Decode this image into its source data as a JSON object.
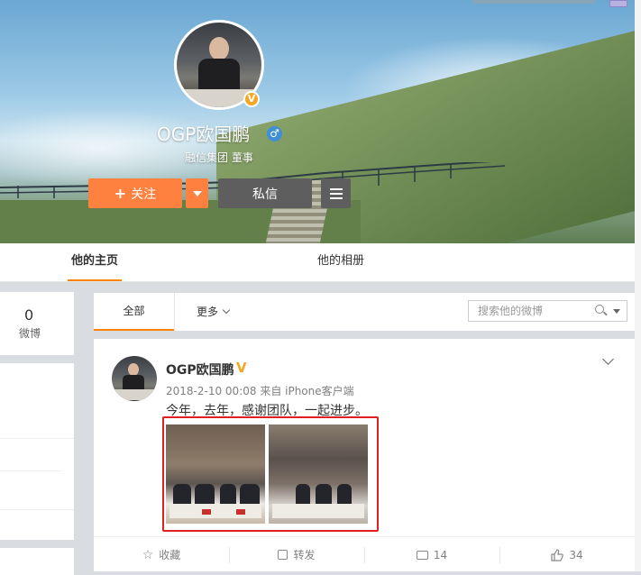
{
  "profile": {
    "name": "OGP欧国鹏",
    "description": "融信集团 董事",
    "verified_badge": "V",
    "gender": "♂",
    "follow_label": "关注",
    "message_label": "私信"
  },
  "tabs": [
    {
      "label": "他的主页",
      "active": true
    },
    {
      "label": "他的相册",
      "active": false
    }
  ],
  "stats": {
    "weibo_count": "0",
    "weibo_label": "微博"
  },
  "filter": {
    "all_label": "全部",
    "more_label": "更多",
    "search_placeholder": "搜索他的微博"
  },
  "post": {
    "author": "OGP欧国鹏",
    "verified_badge": "V",
    "meta": "2018-2-10 00:08 来自 iPhone客户端",
    "text": "今年，去年，感谢团队，一起进步。",
    "actions": {
      "favorite_label": "收藏",
      "repost_label": "转发",
      "comment_count": "14",
      "like_count": "34"
    }
  },
  "icons": {
    "favorite": "star-icon",
    "repost": "share-icon",
    "comment": "comment-icon",
    "like": "thumbs-up-icon",
    "search": "search-icon",
    "menu": "hamburger-icon"
  },
  "colors": {
    "accent": "#ff8140",
    "tab_underline": "#ff8200",
    "badge": "#f5a623",
    "highlight_frame": "#e02020"
  }
}
